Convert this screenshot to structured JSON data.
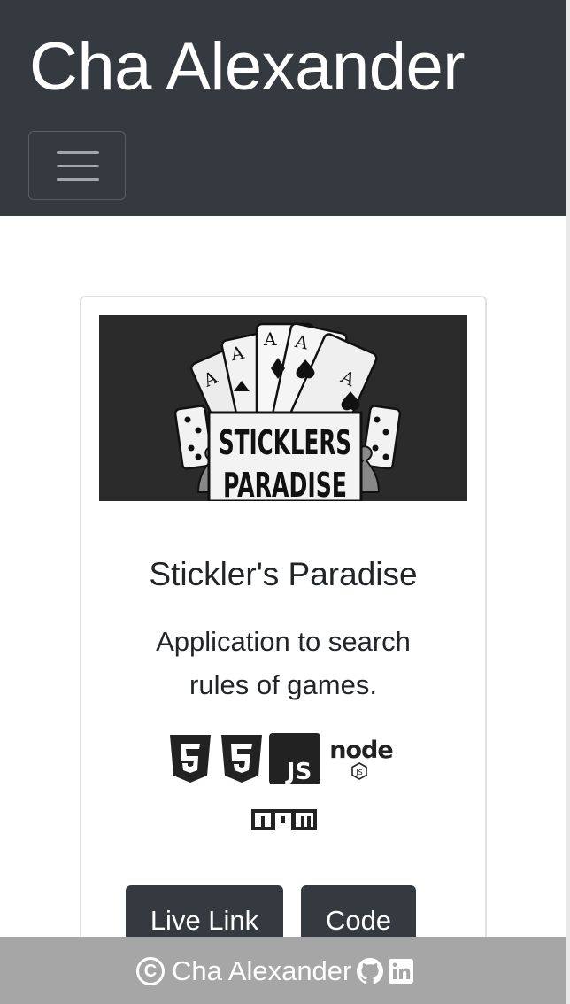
{
  "navbar": {
    "brand": "Cha Alexander",
    "toggler_icon": "hamburger-menu-icon"
  },
  "project": {
    "image_text_line1": "STICKLERS",
    "image_text_line2": "PARADISE",
    "title": "Stickler's Paradise",
    "description": "Application to search rules of games.",
    "tech_icons": [
      "html5-icon",
      "css3-icon",
      "javascript-icon",
      "nodejs-icon",
      "npm-icon"
    ],
    "live_label": "Live Link",
    "code_label": "Code"
  },
  "footer": {
    "copyright_symbol": "C",
    "name": "Cha Alexander",
    "icons": [
      "github-icon",
      "linkedin-icon"
    ]
  },
  "colors": {
    "navbar_bg": "#343a40",
    "button_bg": "#343a40",
    "footer_bg": "#a6a6a6"
  }
}
